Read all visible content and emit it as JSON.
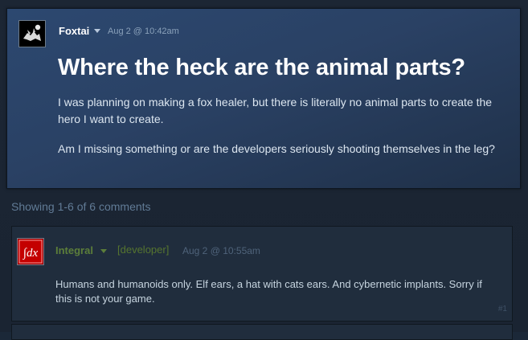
{
  "post": {
    "author": "Foxtai",
    "date": "Aug 2 @ 10:42am",
    "title": "Where the heck are the animal parts?",
    "paragraphs": [
      "I was planning on making a fox healer, but there is literally no animal parts to create the hero I want to create.",
      "Am I missing something or are the developers seriously shooting themselves in the leg?"
    ]
  },
  "comments_summary": "Showing 1-6 of 6 comments",
  "comments": [
    {
      "author": "Integral",
      "role": "[developer]",
      "date": "Aug 2 @ 10:55am",
      "text": "Humans and humanoids only. Elf ears, a hat with cats ears. And cybernetic implants. Sorry if this is not your game.",
      "number": "#1",
      "avatar_text": "∫dx"
    }
  ],
  "colors": {
    "developer_green": "#5c7e3a",
    "op_card_blue": "#2c4870",
    "page_bg": "#1b2838"
  }
}
